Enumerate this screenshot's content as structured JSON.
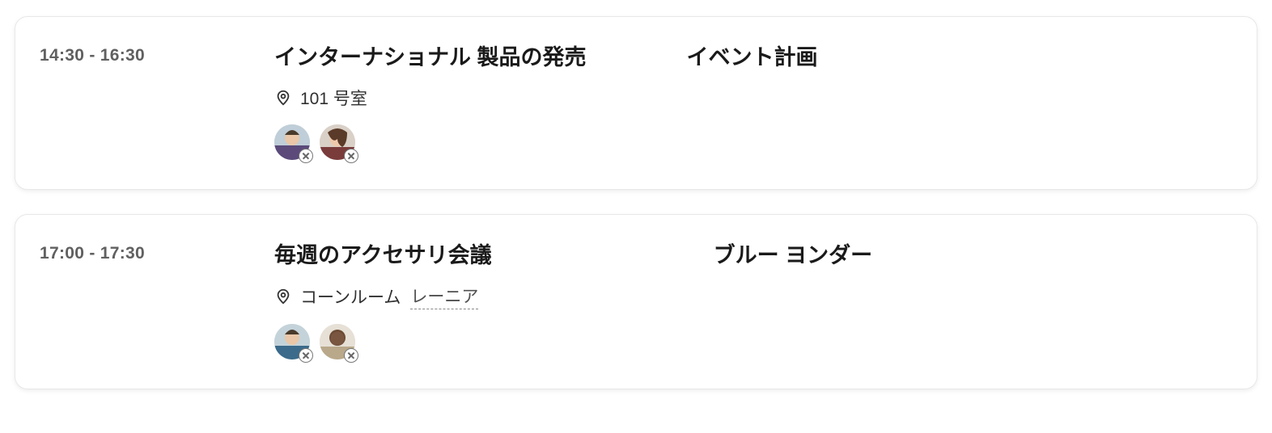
{
  "events": [
    {
      "time": "14:30 - 16:30",
      "title_primary": "インターナショナル  製品の発売",
      "title_secondary": "イベント計画",
      "location_primary": "101 号室",
      "location_secondary": "",
      "attendees": [
        "person-1",
        "person-2"
      ]
    },
    {
      "time": "17:00 - 17:30",
      "title_primary": "毎週のアクセサリ会議",
      "title_secondary": "ブルー ヨンダー",
      "location_primary": "コーンルーム",
      "location_secondary": "レーニア",
      "attendees": [
        "person-3",
        "person-4"
      ]
    }
  ],
  "icons": {
    "location": "location-icon",
    "presence_unknown": "presence-unknown-icon"
  }
}
